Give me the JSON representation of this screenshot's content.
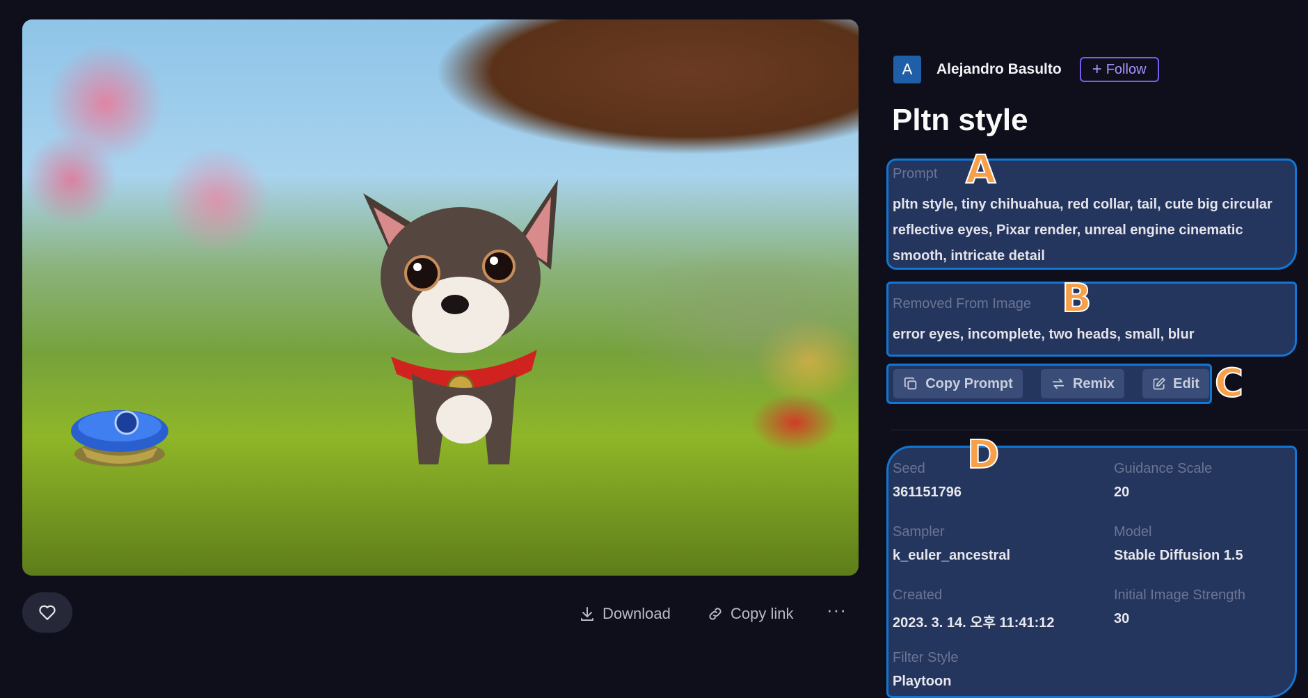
{
  "author": {
    "initial": "A",
    "name": "Alejandro Basulto",
    "follow_label": "Follow"
  },
  "title": "Pltn style",
  "prompt": {
    "label": "Prompt",
    "text": "pltn style, tiny chihuahua, red collar, tail, cute big circular reflective eyes, Pixar render, unreal engine cinematic smooth, intricate detail"
  },
  "negative": {
    "label": "Removed From Image",
    "text": "error eyes, incomplete, two heads, small, blur"
  },
  "tools": {
    "copy_prompt": "Copy Prompt",
    "remix": "Remix",
    "edit": "Edit"
  },
  "markers": {
    "a": "A",
    "b": "B",
    "c": "C",
    "d": "D"
  },
  "meta": {
    "seed_label": "Seed",
    "seed": "361151796",
    "guidance_label": "Guidance Scale",
    "guidance": "20",
    "sampler_label": "Sampler",
    "sampler": "k_euler_ancestral",
    "model_label": "Model",
    "model": "Stable Diffusion 1.5",
    "created_label": "Created",
    "created": "2023. 3. 14. 오후 11:41:12",
    "strength_label": "Initial Image Strength",
    "strength": "30",
    "filter_label": "Filter Style",
    "filter": "Playtoon"
  },
  "actions": {
    "download": "Download",
    "copy_link": "Copy link",
    "more": "···"
  },
  "colors": {
    "accent": "#7b5cf0",
    "highlight": "#1177d6",
    "marker": "#f7a04a"
  }
}
